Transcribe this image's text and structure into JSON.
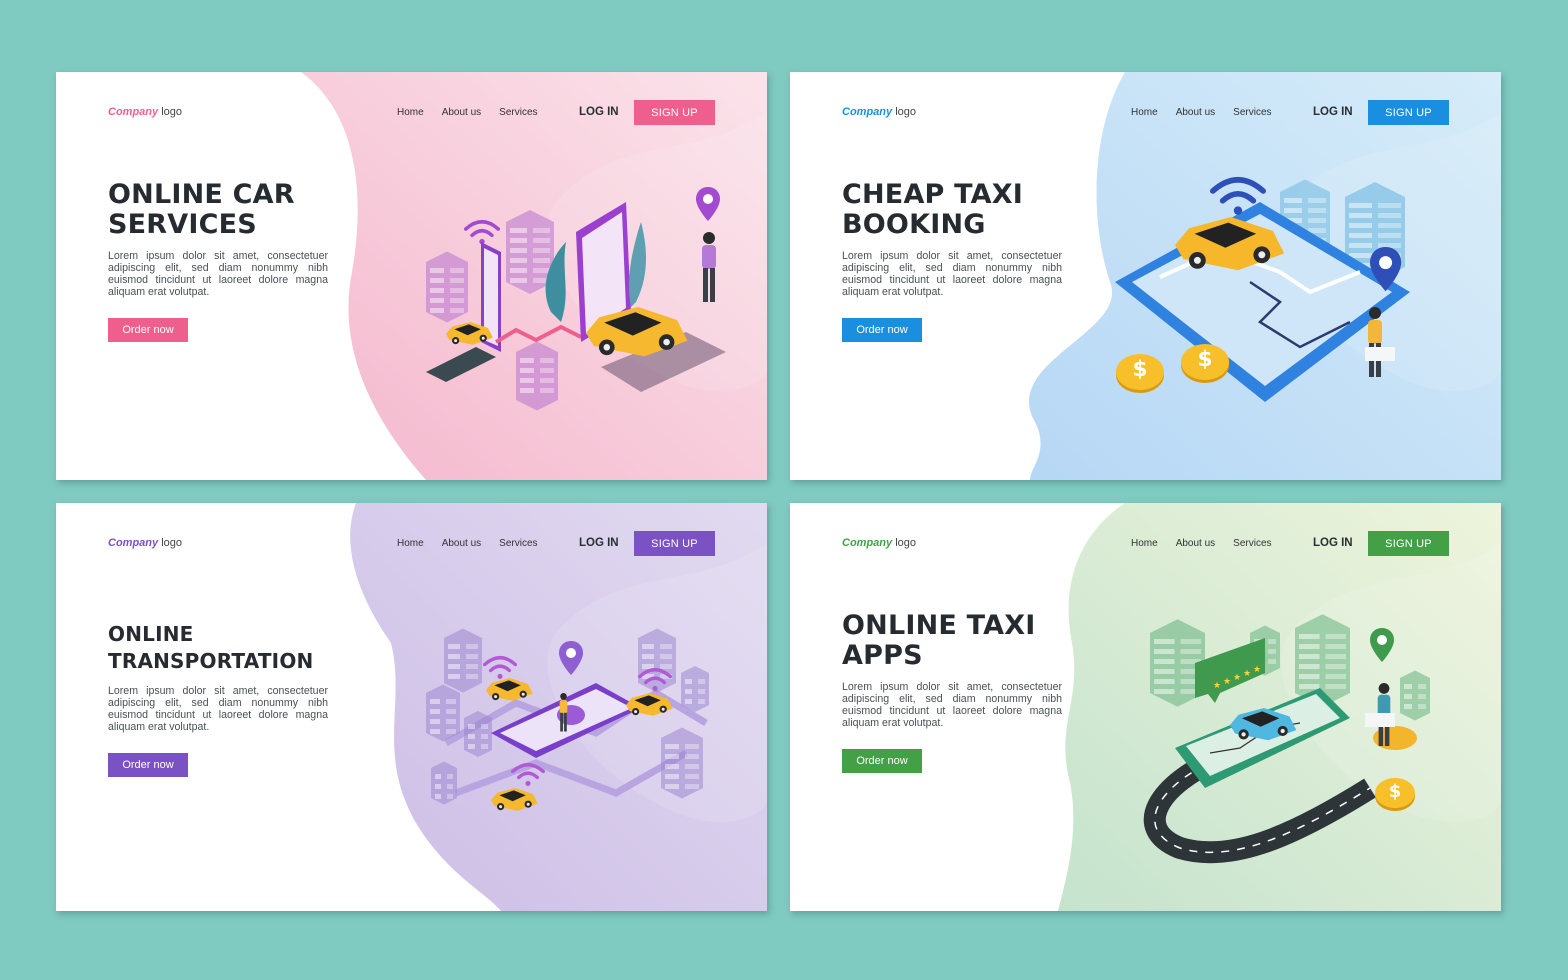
{
  "panels": [
    {
      "theme": {
        "accent": "#ee5f8e",
        "bg_from": "#f4b7cd",
        "bg_to": "#fbe3ea",
        "art": "#a24bd0"
      },
      "nav": {
        "logo_brand": "Company",
        "logo_suffix": "logo",
        "links": [
          "Home",
          "About us",
          "Services"
        ],
        "login": "LOG IN",
        "signup": "SIGN UP"
      },
      "hero": {
        "title_line1": "ONLINE CAR",
        "title_line2": "SERVICES",
        "description": "Lorem ipsum dolor sit amet, consectetuer adipiscing elit, sed diam nonummy nibh euismod tincidunt ut laoreet dolore magna aliquam erat volutpat.",
        "cta": "Order now"
      }
    },
    {
      "theme": {
        "accent": "#1a8fe0",
        "bg_from": "#b6d7f5",
        "bg_to": "#d6ecf9",
        "art": "#2f4fb8"
      },
      "nav": {
        "logo_brand": "Company",
        "logo_suffix": "logo",
        "links": [
          "Home",
          "About us",
          "Services"
        ],
        "login": "LOG IN",
        "signup": "SIGN UP"
      },
      "hero": {
        "title_line1": "CHEAP TAXI",
        "title_line2": "BOOKING",
        "description": "Lorem ipsum dolor sit amet, consectetuer adipiscing elit, sed diam nonummy nibh euismod tincidunt ut laoreet dolore magna aliquam erat volutpat.",
        "cta": "Order now"
      }
    },
    {
      "theme": {
        "accent": "#7b52c4",
        "bg_from": "#cdbde6",
        "bg_to": "#e1daf0",
        "art": "#8e5fd1"
      },
      "nav": {
        "logo_brand": "Company",
        "logo_suffix": "logo",
        "links": [
          "Home",
          "About us",
          "Services"
        ],
        "login": "LOG IN",
        "signup": "SIGN UP"
      },
      "hero": {
        "title_line1": "ONLINE",
        "title_line2": "TRANSPORTATION",
        "description": "Lorem ipsum dolor sit amet, consectetuer adipiscing elit, sed diam nonummy nibh euismod tincidunt ut laoreet dolore magna aliquam erat volutpat.",
        "cta": "Order now"
      }
    },
    {
      "theme": {
        "accent": "#43a047",
        "bg_from": "#c5e3cd",
        "bg_to": "#eef4dc",
        "art": "#2f9a6a"
      },
      "nav": {
        "logo_brand": "Company",
        "logo_suffix": "logo",
        "links": [
          "Home",
          "About us",
          "Services"
        ],
        "login": "LOG IN",
        "signup": "SIGN UP"
      },
      "hero": {
        "title_line1": "ONLINE TAXI",
        "title_line2": "APPS",
        "description": "Lorem ipsum dolor sit amet, consectetuer adipiscing elit, sed diam nonummy nibh euismod tincidunt ut laoreet dolore magna aliquam erat volutpat.",
        "cta": "Order now"
      }
    }
  ]
}
